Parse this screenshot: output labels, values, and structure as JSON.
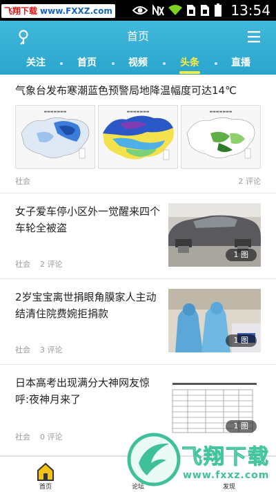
{
  "status_bar": {
    "watermark_name": "飞翔下载",
    "watermark_url": "www.FXXZ.com",
    "time": "13:54"
  },
  "header": {
    "title": "首页",
    "tabs": [
      {
        "label": "关注",
        "active": false
      },
      {
        "label": "首页",
        "active": false
      },
      {
        "label": "视频",
        "active": false
      },
      {
        "label": "头条",
        "active": true
      },
      {
        "label": "直播",
        "active": false
      }
    ]
  },
  "articles": [
    {
      "title": "气象台发布寒潮蓝色预警局地降温幅度可达14℃",
      "category": "社会",
      "comments": "2 评论",
      "thumbs": [
        "map-1",
        "map-2",
        "map-3"
      ]
    },
    {
      "title": "女子爱车停小区外一觉醒来四个车轮全被盗",
      "category": "社会",
      "comments": "2 评论",
      "badge": "1 图"
    },
    {
      "title": "2岁宝宝离世捐眼角膜家人主动结清住院费婉拒捐款",
      "category": "社会",
      "comments": "3 评论",
      "badge": "1 图"
    },
    {
      "title": "日本高考出现满分大神网友惊呼:夜神月来了",
      "category": "社会",
      "comments": "0 评论",
      "badge": "1 图"
    }
  ],
  "bottom_nav": [
    {
      "label": "首页",
      "icon": "home-icon"
    },
    {
      "label": "论坛",
      "icon": "forum-icon"
    },
    {
      "label": "发现",
      "icon": "discover-icon"
    }
  ],
  "watermark": {
    "logo_text": "飞翔下载",
    "logo_url": "www.fxxz.com"
  },
  "colors": {
    "header": "#2ba5cd",
    "active_tab": "#ffec3d"
  }
}
